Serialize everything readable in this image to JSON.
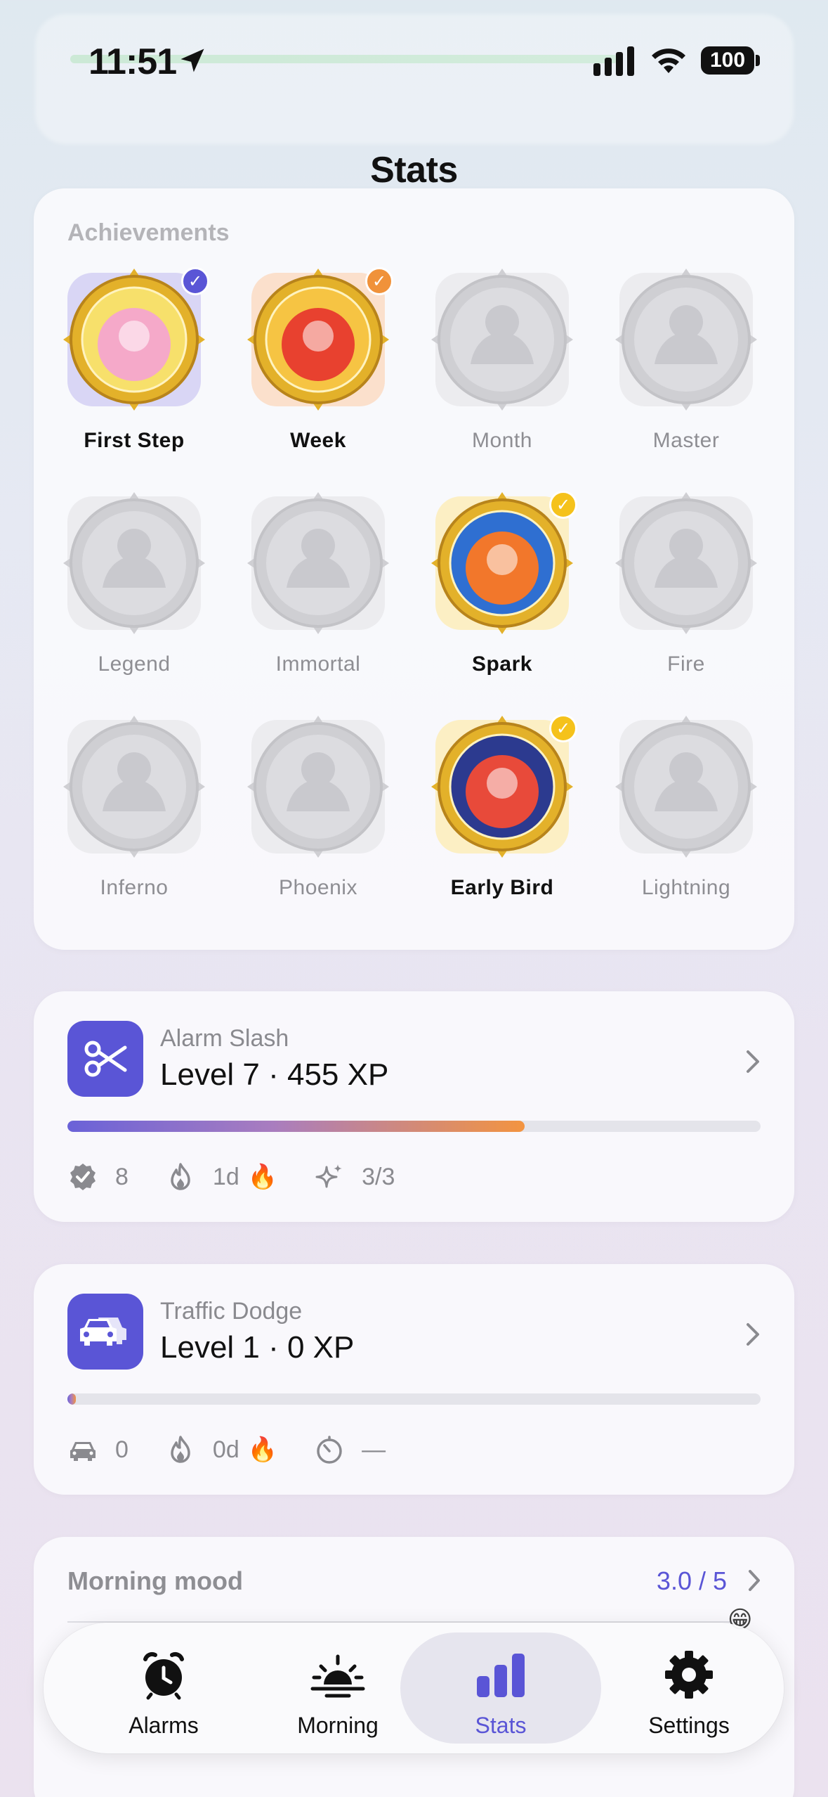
{
  "status_bar": {
    "time": "11:51",
    "battery": "100"
  },
  "page": {
    "title": "Stats"
  },
  "achievements": {
    "header": "Achievements",
    "items": [
      {
        "label": "First Step",
        "unlocked": true,
        "check_color": "#5a55d6",
        "frame": "#d9d6f5"
      },
      {
        "label": "Week",
        "unlocked": true,
        "check_color": "#f0923a",
        "frame": "#fbe0cc"
      },
      {
        "label": "Month",
        "unlocked": false
      },
      {
        "label": "Master",
        "unlocked": false
      },
      {
        "label": "Legend",
        "unlocked": false
      },
      {
        "label": "Immortal",
        "unlocked": false
      },
      {
        "label": "Spark",
        "unlocked": true,
        "check_color": "#f5c21b",
        "frame": "#fcefc4"
      },
      {
        "label": "Fire",
        "unlocked": false
      },
      {
        "label": "Inferno",
        "unlocked": false
      },
      {
        "label": "Phoenix",
        "unlocked": false
      },
      {
        "label": "Early Bird",
        "unlocked": true,
        "check_color": "#f5c21b",
        "frame": "#fcefc4"
      },
      {
        "label": "Lightning",
        "unlocked": false
      }
    ]
  },
  "games": [
    {
      "name": "Alarm Slash",
      "level": "Level 7 · 455 XP",
      "progress": 0.66,
      "stats": [
        {
          "icon": "verified-badge-icon",
          "value": "8"
        },
        {
          "icon": "flame-icon",
          "value": "1d",
          "emoji": "🔥"
        },
        {
          "icon": "sparkles-icon",
          "value": "3/3"
        }
      ]
    },
    {
      "name": "Traffic Dodge",
      "level": "Level 1 · 0 XP",
      "progress": 0.01,
      "stats": [
        {
          "icon": "car-icon",
          "value": "0"
        },
        {
          "icon": "flame-icon",
          "value": "0d",
          "emoji": "🔥"
        },
        {
          "icon": "timer-icon",
          "value": "—"
        }
      ]
    }
  ],
  "mood": {
    "title": "Morning mood",
    "value": "3.0 / 5",
    "emoji": "😁"
  },
  "tabs": [
    {
      "label": "Alarms",
      "icon": "alarm-clock-icon",
      "active": false
    },
    {
      "label": "Morning",
      "icon": "sunrise-icon",
      "active": false
    },
    {
      "label": "Stats",
      "icon": "bar-chart-icon",
      "active": true
    },
    {
      "label": "Settings",
      "icon": "gear-icon",
      "active": false
    }
  ],
  "colors": {
    "accent": "#5a55d6",
    "orange": "#f39440"
  }
}
